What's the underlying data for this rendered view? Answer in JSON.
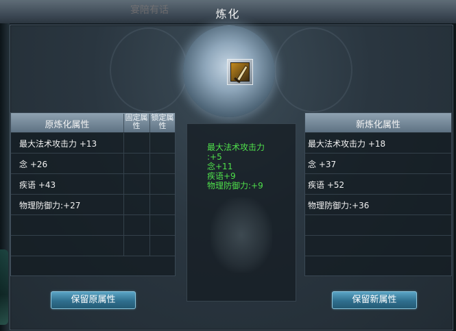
{
  "window": {
    "title": "炼化",
    "ghost_text": "宴陪有话"
  },
  "item_slot": {
    "icon": "sword-icon",
    "selected": true
  },
  "left_table": {
    "header": "原炼化属性",
    "col_fixed": "固定属性",
    "col_locked": "锁定属性",
    "rows": [
      "最大法术攻击力 +13",
      "念 +26",
      "疾语 +43",
      "物理防御力:+27",
      "",
      "",
      ""
    ]
  },
  "middle": {
    "lines": [
      "最大法术攻击力",
      ":+5",
      "念+11",
      "疾语+9",
      "物理防御力:+9"
    ],
    "text_color": "#4fe04b"
  },
  "right_table": {
    "header": "新炼化属性",
    "rows": [
      "最大法术攻击力 +18",
      "念 +37",
      "疾语 +52",
      "物理防御力:+36",
      "",
      "",
      ""
    ]
  },
  "buttons": {
    "keep_original": "保留原属性",
    "keep_new": "保留新属性"
  }
}
